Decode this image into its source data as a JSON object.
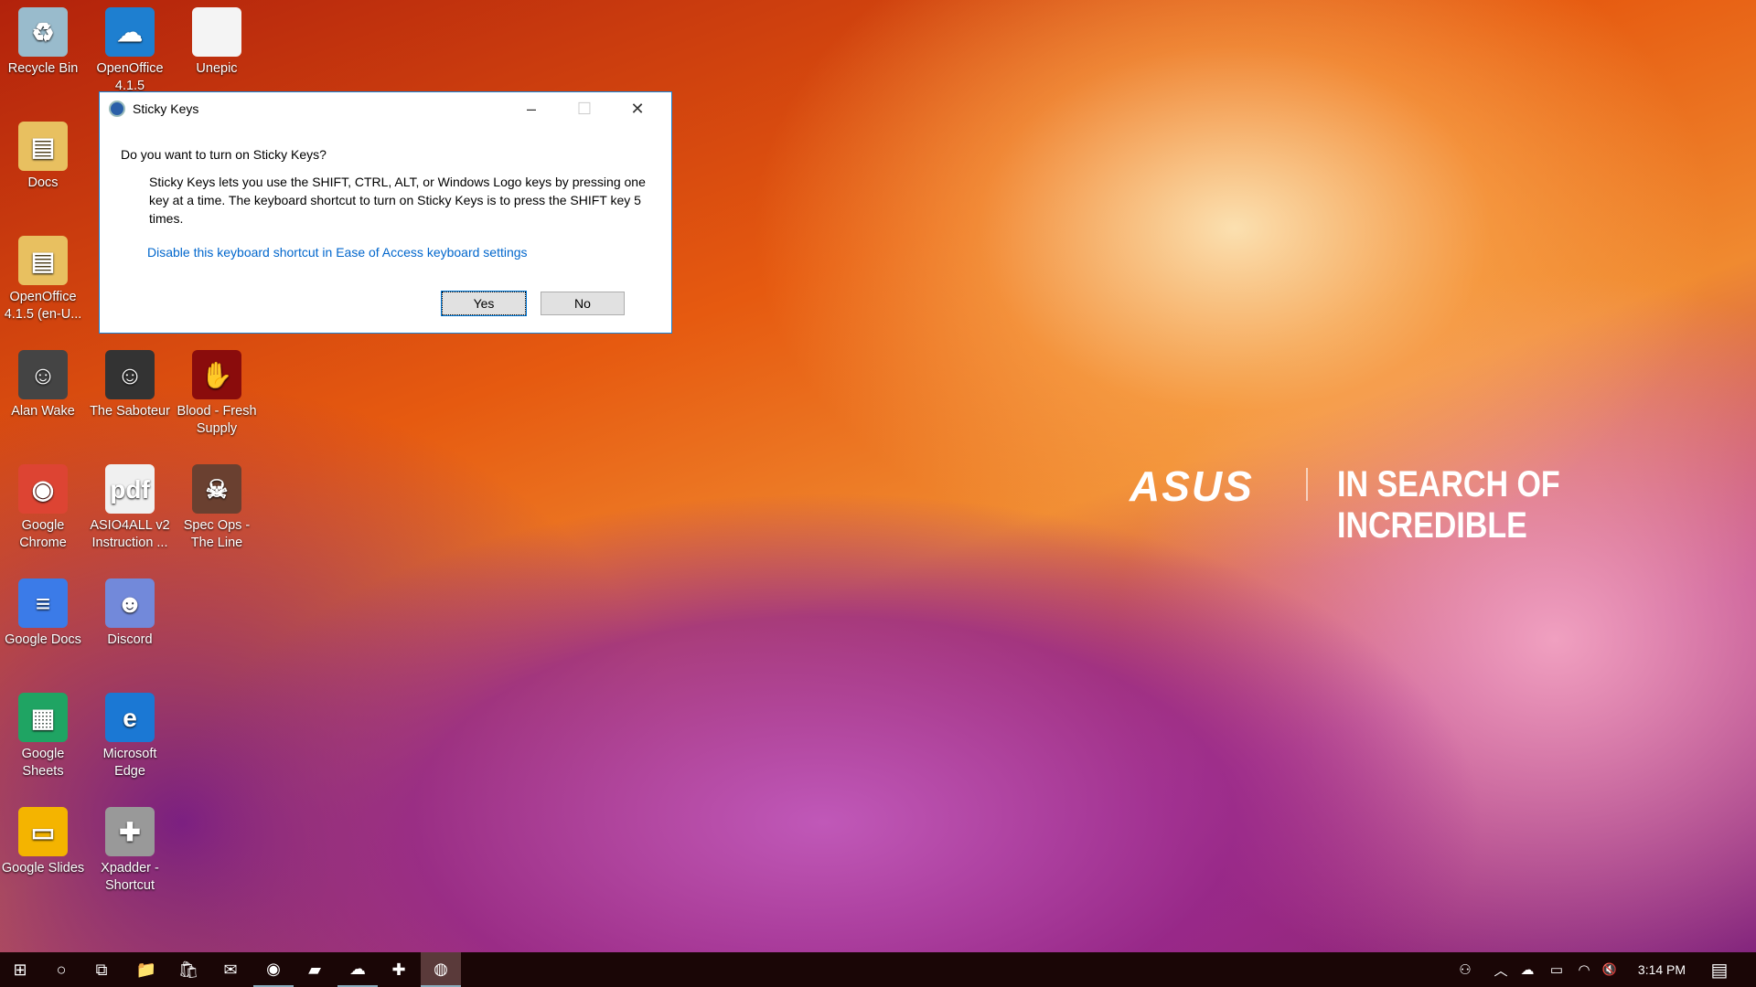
{
  "desktop": {
    "icons": [
      {
        "label": "Recycle Bin",
        "glyph": "♻",
        "color": "#9bc"
      },
      {
        "label": "OpenOffice 4.1.5",
        "glyph": "☁",
        "color": "#1e7fd0"
      },
      {
        "label": "Unepic",
        "glyph": "",
        "color": "#f4f4f4"
      },
      {
        "label": "Docs",
        "glyph": "▤",
        "color": "#e8c060"
      },
      {
        "label": "OpenOffice 4.1.5 (en-U...",
        "glyph": "▤",
        "color": "#e8c060"
      },
      {
        "label": "Alan Wake",
        "glyph": "☺",
        "color": "#444"
      },
      {
        "label": "The Saboteur",
        "glyph": "☺",
        "color": "#333"
      },
      {
        "label": "Blood - Fresh Supply",
        "glyph": "✋",
        "color": "#8a0c0c"
      },
      {
        "label": "Google Chrome",
        "glyph": "◉",
        "color": "#dd4433"
      },
      {
        "label": "ASIO4ALL v2 Instruction ...",
        "glyph": "pdf",
        "color": "#f0f0f0"
      },
      {
        "label": "Spec Ops - The Line",
        "glyph": "☠",
        "color": "#6a4030"
      },
      {
        "label": "Google Docs",
        "glyph": "≡",
        "color": "#3b7be8"
      },
      {
        "label": "Discord",
        "glyph": "☻",
        "color": "#7289da"
      },
      {
        "label": "Google Sheets",
        "glyph": "▦",
        "color": "#1fa463"
      },
      {
        "label": "Microsoft Edge",
        "glyph": "e",
        "color": "#1b78d4"
      },
      {
        "label": "Google Slides",
        "glyph": "▭",
        "color": "#f4b400"
      },
      {
        "label": "Xpadder - Shortcut",
        "glyph": "✚",
        "color": "#999"
      }
    ]
  },
  "wallpaper": {
    "brand": "ASUS",
    "tagline": "IN SEARCH OF INCREDIBLE"
  },
  "dialog": {
    "title": "Sticky Keys",
    "question": "Do you want to turn on Sticky Keys?",
    "description": "Sticky Keys lets you use the SHIFT, CTRL, ALT, or Windows Logo keys by pressing one key at a time. The keyboard shortcut to turn on Sticky Keys is to press the SHIFT key 5 times.",
    "link": "Disable this keyboard shortcut in Ease of Access keyboard settings",
    "link_color": "#0066cc",
    "yes": "Yes",
    "no": "No",
    "minimize": "–",
    "maximize": "☐",
    "close": "✕"
  },
  "taskbar": {
    "apps": [
      {
        "name": "start",
        "glyph": "⊞"
      },
      {
        "name": "search",
        "glyph": "○"
      },
      {
        "name": "task-view",
        "glyph": "⧉"
      },
      {
        "name": "file-explorer",
        "glyph": "📁"
      },
      {
        "name": "store",
        "glyph": "🛍"
      },
      {
        "name": "mail",
        "glyph": "✉"
      },
      {
        "name": "chrome",
        "glyph": "◉"
      },
      {
        "name": "app",
        "glyph": "▰"
      },
      {
        "name": "openoffice",
        "glyph": "☁"
      },
      {
        "name": "xpadder",
        "glyph": "✚"
      },
      {
        "name": "sticky-keys",
        "glyph": "◍"
      }
    ],
    "tray": {
      "people": "⚇",
      "chevron": "︿",
      "onedrive": "☁",
      "battery": "▭",
      "wifi": "◠",
      "volume": "🔇",
      "time": "3:14 PM",
      "notifications": "▤"
    }
  }
}
